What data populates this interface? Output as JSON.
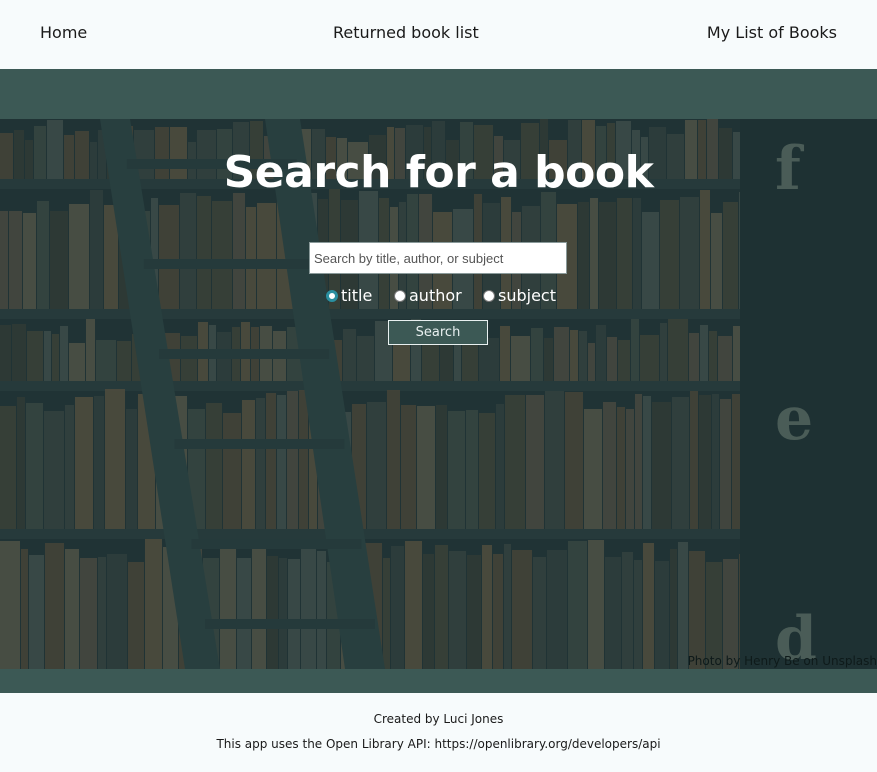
{
  "nav": {
    "home": "Home",
    "returned": "Returned book list",
    "my_list": "My List of Books"
  },
  "hero": {
    "title": "Search for a book",
    "search_placeholder": "Search by title, author, or subject",
    "radio_options": [
      "title",
      "author",
      "subject"
    ],
    "selected_option": "title",
    "search_button": "Search",
    "photo_credit": "Photo by Henry Be on Unsplash"
  },
  "footer": {
    "created_by": "Created by Luci Jones",
    "api_note": "This app uses the Open Library API: https://openlibrary.org/developers/api"
  },
  "colors": {
    "band": "#3c5955",
    "page_bg": "#f7fbfc",
    "radio_checked": "#2a8fa0"
  }
}
